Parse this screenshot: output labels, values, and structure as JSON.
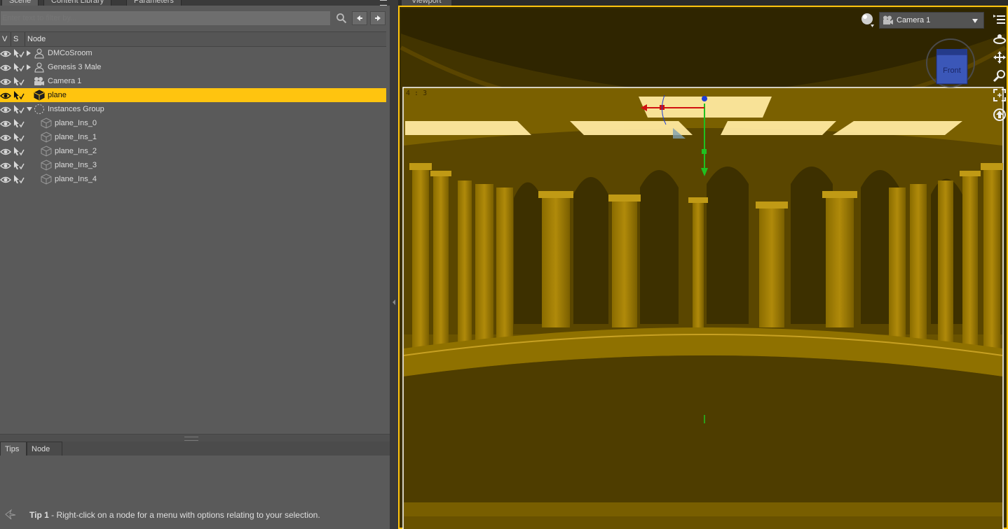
{
  "left_panel": {
    "tabs": [
      "Scene",
      "Content Library",
      "Parameters"
    ],
    "filter_placeholder": "Enter text to filter by...",
    "columns": {
      "v": "V",
      "s": "S",
      "node": "Node"
    },
    "nodes": [
      {
        "label": "DMCoSroom",
        "indent": 0,
        "expander": "right",
        "icon": "figure-icon",
        "selected": false
      },
      {
        "label": "Genesis 3 Male",
        "indent": 0,
        "expander": "right",
        "icon": "figure-icon",
        "selected": false
      },
      {
        "label": "Camera 1",
        "indent": 0,
        "expander": "none",
        "icon": "camera-icon",
        "selected": false
      },
      {
        "label": "plane",
        "indent": 0,
        "expander": "none",
        "icon": "cube-icon",
        "selected": true
      },
      {
        "label": "Instances Group",
        "indent": 0,
        "expander": "down",
        "icon": "group-icon",
        "selected": false
      },
      {
        "label": "plane_Ins_0",
        "indent": 1,
        "expander": "none",
        "icon": "instance-icon",
        "selected": false
      },
      {
        "label": "plane_Ins_1",
        "indent": 1,
        "expander": "none",
        "icon": "instance-icon",
        "selected": false
      },
      {
        "label": "plane_Ins_2",
        "indent": 1,
        "expander": "none",
        "icon": "instance-icon",
        "selected": false
      },
      {
        "label": "plane_Ins_3",
        "indent": 1,
        "expander": "none",
        "icon": "instance-icon",
        "selected": false
      },
      {
        "label": "plane_Ins_4",
        "indent": 1,
        "expander": "none",
        "icon": "instance-icon",
        "selected": false
      }
    ],
    "bottom_tabs": [
      "Tips",
      "Node"
    ],
    "tip": {
      "prefix": "Tip 1",
      "text": " - Right-click on a node for a menu with options relating to your selection."
    }
  },
  "viewport": {
    "tab": "Viewport",
    "camera": "Camera 1",
    "aspect": "4 : 3",
    "cube_label": "Front",
    "colors": {
      "selection": "#ffc40f",
      "scene_tint": "#6a5300",
      "light_panel": "#ffe9a0"
    }
  }
}
